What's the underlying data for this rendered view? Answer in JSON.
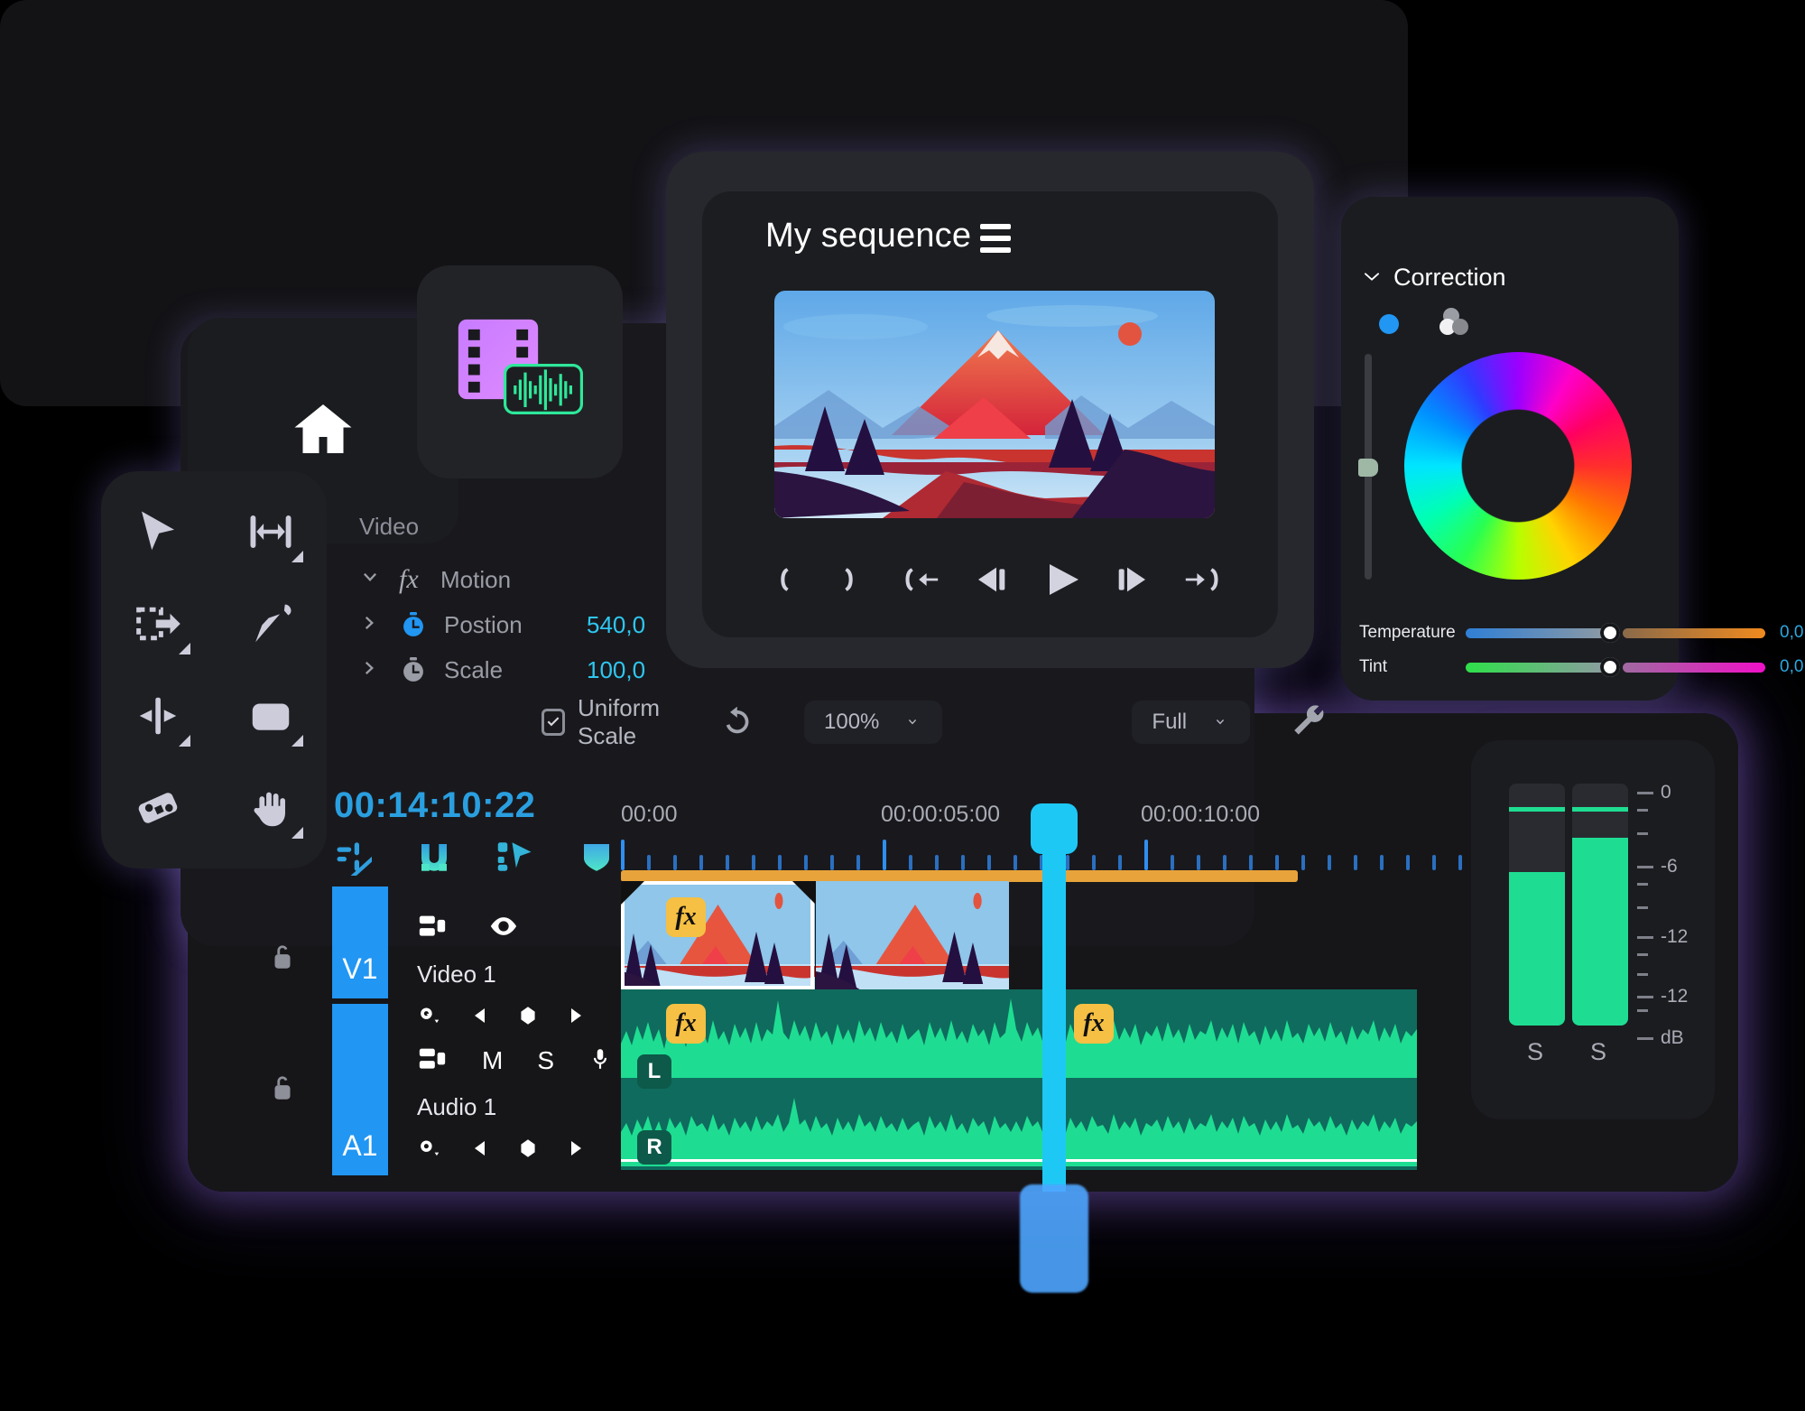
{
  "app": {
    "name": "video-editor"
  },
  "monitor": {
    "title": "My sequence",
    "menu_icon": "hamburger-icon",
    "transport": [
      {
        "name": "mark-in-button",
        "icon": "mark-in-icon"
      },
      {
        "name": "mark-out-button",
        "icon": "mark-out-icon"
      },
      {
        "name": "go-to-in-button",
        "icon": "go-to-in-icon"
      },
      {
        "name": "step-back-button",
        "icon": "step-back-icon"
      },
      {
        "name": "play-button",
        "icon": "play-icon"
      },
      {
        "name": "step-forward-button",
        "icon": "step-forward-icon"
      },
      {
        "name": "go-to-out-button",
        "icon": "go-to-out-icon"
      }
    ]
  },
  "monitor_bar": {
    "uniform_scale_label": "Uniform Scale",
    "uniform_scale_checked": true,
    "reset_icon": "reset-icon",
    "zoom_value": "100%",
    "quality_value": "Full",
    "wrench_icon": "wrench-icon"
  },
  "properties": {
    "section_title": "Video",
    "effect_name": "Motion",
    "effect_icon": "fx-icon",
    "rows": [
      {
        "name": "Postion",
        "value1": "540,0",
        "value2": "540,"
      },
      {
        "name": "Scale",
        "value1": "100,0",
        "value2": ""
      }
    ]
  },
  "correction": {
    "title": "Correction",
    "collapse_icon": "chevron-down-icon",
    "mode_basic_icon": "color-dot-icon",
    "mode_wheels_icon": "three-circles-icon",
    "sliders": [
      {
        "label": "Temperature",
        "value": "0,0",
        "from": "#2f7fd6",
        "to": "#f08a1e"
      },
      {
        "label": "Tint",
        "value": "0,0",
        "from": "#2ee04a",
        "to": "#f010c8"
      }
    ]
  },
  "tools": [
    {
      "name": "selection-tool",
      "icon": "arrow-cursor-icon"
    },
    {
      "name": "track-select-tool",
      "icon": "track-select-icon"
    },
    {
      "name": "ripple-edit-tool",
      "icon": "ripple-edit-icon"
    },
    {
      "name": "pen-tool",
      "icon": "pen-icon"
    },
    {
      "name": "rolling-edit-tool",
      "icon": "rolling-edit-icon"
    },
    {
      "name": "rate-stretch-tool",
      "icon": "rounded-rect-icon"
    },
    {
      "name": "slip-tool",
      "icon": "slip-icon"
    },
    {
      "name": "hand-tool",
      "icon": "hand-icon"
    }
  ],
  "home_button": {
    "icon": "home-icon"
  },
  "media_tile": {
    "video_icon": "film-strip-icon",
    "audio_icon": "waveform-icon"
  },
  "timeline": {
    "timecode": "00:14:10:22",
    "toolbar_icons": [
      {
        "name": "linked-selection-toggle",
        "icon": "link-slash-icon"
      },
      {
        "name": "snap-toggle",
        "icon": "magnet-icon"
      },
      {
        "name": "markers-toggle",
        "icon": "marker-arrow-icon"
      },
      {
        "name": "shield-toggle",
        "icon": "shield-icon"
      }
    ],
    "ruler_labels": [
      "00:00",
      "00:00:05:00",
      "00:00:10:00"
    ],
    "tracks": [
      {
        "id": "V1",
        "name": "Video 1",
        "lock_icon": "unlock-icon",
        "controls": [
          "track-output-icon",
          "eye-icon"
        ],
        "keyframe_controls": [
          "keyframe-menu-icon",
          "prev-keyframe-icon",
          "add-keyframe-icon",
          "next-keyframe-icon"
        ]
      },
      {
        "id": "A1",
        "name": "Audio 1",
        "lock_icon": "unlock-icon",
        "controls": [
          "track-output-icon",
          "M",
          "S",
          "mic-icon"
        ],
        "keyframe_controls": [
          "keyframe-menu-icon",
          "prev-keyframe-icon",
          "add-keyframe-icon",
          "next-keyframe-icon"
        ]
      }
    ],
    "clip_badges": {
      "video_fx": "fx",
      "audio_fx": "fx",
      "left_channel": "L",
      "right_channel": "R"
    }
  },
  "meters": {
    "scale_labels": [
      "0",
      "-6",
      "-12",
      "-12",
      "dB"
    ],
    "solo_left": "S",
    "solo_right": "S"
  }
}
